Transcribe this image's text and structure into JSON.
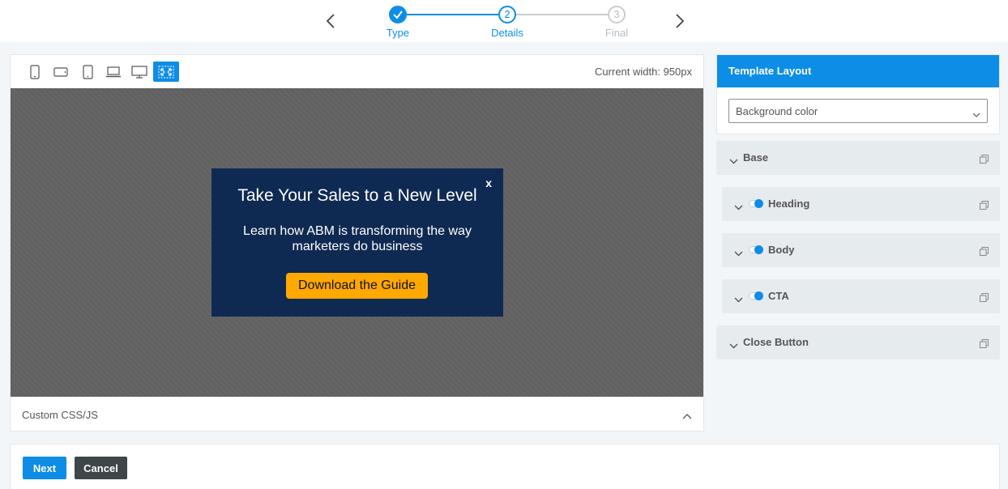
{
  "stepper": {
    "steps": [
      {
        "number": "",
        "label": "Type",
        "state": "complete"
      },
      {
        "number": "2",
        "label": "Details",
        "state": "current"
      },
      {
        "number": "3",
        "label": "Final",
        "state": "upcoming"
      }
    ],
    "prev_icon": "chevron-left-icon",
    "next_icon": "chevron-right-icon"
  },
  "preview": {
    "devices": [
      {
        "name": "mobile-portrait",
        "icon": "phone-portrait-icon",
        "active": false
      },
      {
        "name": "mobile-landscape",
        "icon": "phone-landscape-icon",
        "active": false
      },
      {
        "name": "tablet",
        "icon": "tablet-icon",
        "active": false
      },
      {
        "name": "laptop",
        "icon": "laptop-icon",
        "active": false
      },
      {
        "name": "desktop",
        "icon": "desktop-icon",
        "active": false
      },
      {
        "name": "fullscreen",
        "icon": "expand-icon",
        "active": true
      }
    ],
    "current_width": "Current width: 950px",
    "popup": {
      "close_label": "x",
      "heading": "Take Your Sales to a New Level",
      "body": "Learn how ABM is transforming the way marketers do business",
      "cta": "Download the Guide"
    },
    "custom_css_label": "Custom CSS/JS"
  },
  "template_layout": {
    "title": "Template Layout",
    "select_value": "Background color",
    "sections": [
      {
        "label": "Base",
        "toggle": false
      },
      {
        "label": "Heading",
        "toggle": true
      },
      {
        "label": "Body",
        "toggle": true
      },
      {
        "label": "CTA",
        "toggle": true
      },
      {
        "label": "Close Button",
        "toggle": false
      }
    ]
  },
  "footer": {
    "next_label": "Next",
    "cancel_label": "Cancel"
  },
  "colors": {
    "accent": "#0d8de6",
    "popup_bg": "#0f2a52",
    "cta_bg": "#ffa800",
    "canvas_bg": "#616161",
    "cancel_bg": "#3f4649"
  }
}
